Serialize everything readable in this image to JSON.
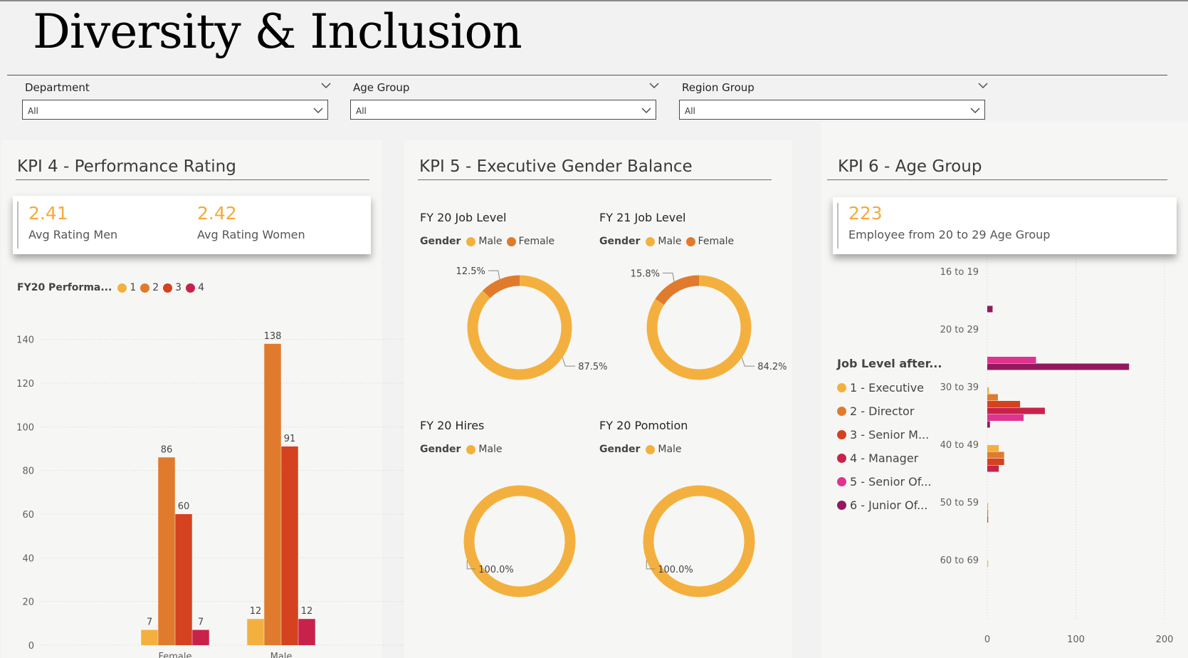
{
  "page": {
    "title": "Diversity & Inclusion"
  },
  "slicers": [
    {
      "label": "Department",
      "value": "All"
    },
    {
      "label": "Age Group",
      "value": "All"
    },
    {
      "label": "Region Group",
      "value": "All"
    }
  ],
  "kpi4": {
    "title": "KPI 4 - Performance Rating",
    "card": {
      "men_value": "2.41",
      "men_label": "Avg Rating Men",
      "women_value": "2.42",
      "women_label": "Avg Rating Women"
    },
    "legend_title": "FY20 Performa...",
    "legend_items": [
      "1",
      "2",
      "3",
      "4"
    ]
  },
  "kpi5": {
    "title": "KPI 5 - Executive Gender Balance",
    "legend_title": "Gender",
    "male_label": "Male",
    "female_label": "Female",
    "charts": [
      {
        "title": "FY 20 Job Level",
        "legend": [
          "Male",
          "Female"
        ]
      },
      {
        "title": "FY 21 Job Level",
        "legend": [
          "Male",
          "Female"
        ]
      },
      {
        "title": "FY 20 Hires",
        "legend": [
          "Male"
        ]
      },
      {
        "title": "FY 20 Pomotion",
        "legend": [
          "Male"
        ]
      }
    ]
  },
  "kpi6": {
    "title": "KPI 6 - Age Group",
    "card": {
      "value": "223",
      "label": "Employee from 20 to 29 Age Group"
    },
    "legend_title": "Job Level after...",
    "legend_items": [
      "1 - Executive",
      "2 - Director",
      "3 - Senior M...",
      "4 - Manager",
      "5 - Senior Of...",
      "6 - Junior Of..."
    ]
  },
  "colors": {
    "c1": "#f4b03e",
    "c2": "#e07b2e",
    "c3": "#d4421f",
    "c4": "#c9224a",
    "c5": "#e0338f",
    "c6": "#93195f",
    "accent": "#f4a93b"
  },
  "chart_data": [
    {
      "id": "perf",
      "type": "bar",
      "categories": [
        "Female",
        "Male"
      ],
      "series": [
        {
          "name": "1",
          "values": [
            7,
            12
          ]
        },
        {
          "name": "2",
          "values": [
            86,
            138
          ]
        },
        {
          "name": "3",
          "values": [
            60,
            91
          ]
        },
        {
          "name": "4",
          "values": [
            7,
            12
          ]
        }
      ],
      "ylim": [
        0,
        150
      ],
      "yticks": [
        0,
        20,
        40,
        60,
        80,
        100,
        120,
        140
      ],
      "grid": true,
      "data_labels": true
    },
    {
      "id": "fy20job",
      "type": "pie",
      "title": "FY 20 Job Level",
      "labels": [
        "Male",
        "Female"
      ],
      "values": [
        87.5,
        12.5
      ],
      "value_labels": [
        "87.5%",
        "12.5%"
      ]
    },
    {
      "id": "fy21job",
      "type": "pie",
      "title": "FY 21 Job Level",
      "labels": [
        "Male",
        "Female"
      ],
      "values": [
        84.2,
        15.8
      ],
      "value_labels": [
        "84.2%",
        "15.8%"
      ]
    },
    {
      "id": "fy20hires",
      "type": "pie",
      "title": "FY 20 Hires",
      "labels": [
        "Male"
      ],
      "values": [
        100.0
      ],
      "value_labels": [
        "100.0%"
      ]
    },
    {
      "id": "fy20promo",
      "type": "pie",
      "title": "FY 20 Pomotion",
      "labels": [
        "Male"
      ],
      "values": [
        100.0
      ],
      "value_labels": [
        "100.0%"
      ]
    },
    {
      "id": "age",
      "type": "bar",
      "orientation": "horizontal",
      "categories": [
        "16 to 19",
        "20 to 29",
        "30 to 39",
        "40 to 49",
        "50 to 59",
        "60 to 69"
      ],
      "series": [
        {
          "name": "1 - Executive",
          "values": [
            0,
            0,
            2,
            13,
            1,
            1
          ]
        },
        {
          "name": "2 - Director",
          "values": [
            0,
            0,
            12,
            19,
            1,
            0
          ]
        },
        {
          "name": "3 - Senior M...",
          "values": [
            0,
            0,
            37,
            19,
            1,
            0
          ]
        },
        {
          "name": "4 - Manager",
          "values": [
            0,
            0,
            65,
            13,
            0,
            0
          ]
        },
        {
          "name": "5 - Senior Of...",
          "values": [
            0,
            55,
            41,
            0,
            0,
            0
          ]
        },
        {
          "name": "6 - Junior Of...",
          "values": [
            6,
            160,
            3,
            0,
            0,
            0
          ]
        }
      ],
      "xlim": [
        0,
        200
      ],
      "xticks": [
        0,
        100,
        200
      ],
      "grid": true
    }
  ]
}
